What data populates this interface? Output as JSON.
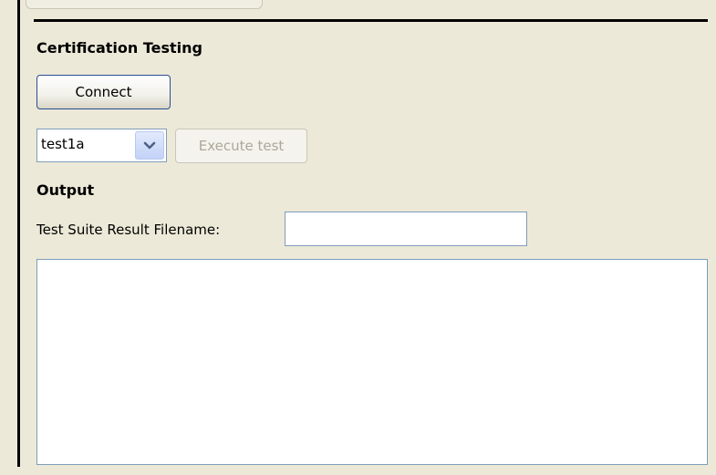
{
  "certification": {
    "heading": "Certification Testing",
    "connect_label": "Connect",
    "test_select": {
      "selected": "test1a",
      "icon": "chevron-down-icon"
    },
    "execute_label": "Execute test"
  },
  "output": {
    "heading": "Output",
    "filename_label": "Test Suite Result Filename:",
    "filename_value": "",
    "text_value": ""
  },
  "colors": {
    "panel_background": "#ece9d8",
    "field_border": "#7f9db9",
    "button_border": "#2b4f8f",
    "disabled_text": "#aca899"
  }
}
